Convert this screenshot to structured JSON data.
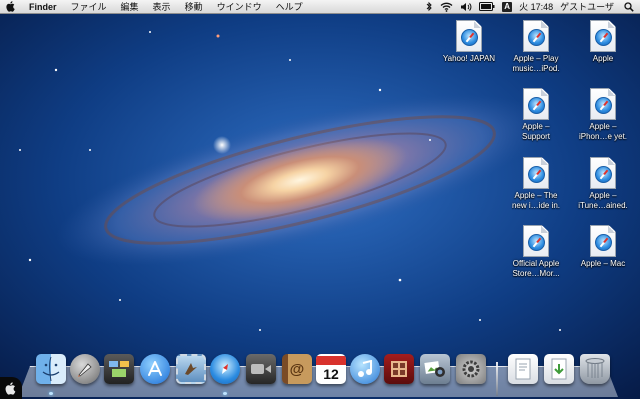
{
  "menubar": {
    "apple_icon": "apple-logo-icon",
    "app_name": "Finder",
    "menus": [
      "ファイル",
      "編集",
      "表示",
      "移動",
      "ウインドウ",
      "ヘルプ"
    ],
    "status": {
      "bluetooth_icon": "bluetooth-icon",
      "wifi_icon": "wifi-icon",
      "volume_icon": "volume-icon",
      "battery_icon": "battery-icon",
      "input_menu": "A",
      "clock": "火 17:48",
      "user": "ゲストユーザ",
      "spotlight_icon": "spotlight-search-icon"
    }
  },
  "desktop_icons": [
    {
      "label_lines": [
        "Yahoo! JAPAN"
      ]
    },
    {
      "label_lines": [
        "Apple – Play",
        "music…iPod."
      ]
    },
    {
      "label_lines": [
        "Apple"
      ]
    },
    {
      "label_lines": [
        "Apple –",
        "Support"
      ]
    },
    {
      "label_lines": [
        "Apple –",
        "iPhon…e yet."
      ]
    },
    {
      "label_lines": [
        "Apple – The",
        "new i…ide in."
      ]
    },
    {
      "label_lines": [
        "Apple –",
        "iTune…ained."
      ]
    },
    {
      "label_lines": [
        "Official Apple",
        "Store…Mor..."
      ]
    },
    {
      "label_lines": [
        "Apple – Mac"
      ]
    }
  ],
  "dock": {
    "apps": [
      {
        "name": "finder-icon"
      },
      {
        "name": "launchpad-icon"
      },
      {
        "name": "mission-control-icon"
      },
      {
        "name": "app-store-icon"
      },
      {
        "name": "mail-icon"
      },
      {
        "name": "safari-icon"
      },
      {
        "name": "facetime-icon"
      },
      {
        "name": "address-book-icon"
      },
      {
        "name": "ical-icon",
        "day": "12"
      },
      {
        "name": "itunes-icon"
      },
      {
        "name": "photo-booth-icon"
      },
      {
        "name": "iphoto-icon"
      },
      {
        "name": "system-preferences-icon"
      }
    ],
    "stacks": [
      {
        "name": "documents-stack-icon"
      },
      {
        "name": "downloads-stack-icon"
      },
      {
        "name": "trash-icon"
      }
    ]
  },
  "colors": {
    "menubar_bg": "#e6e6e6",
    "wallpaper_deep": "#0c2a5e",
    "safari_blue": "#2b8be0"
  }
}
